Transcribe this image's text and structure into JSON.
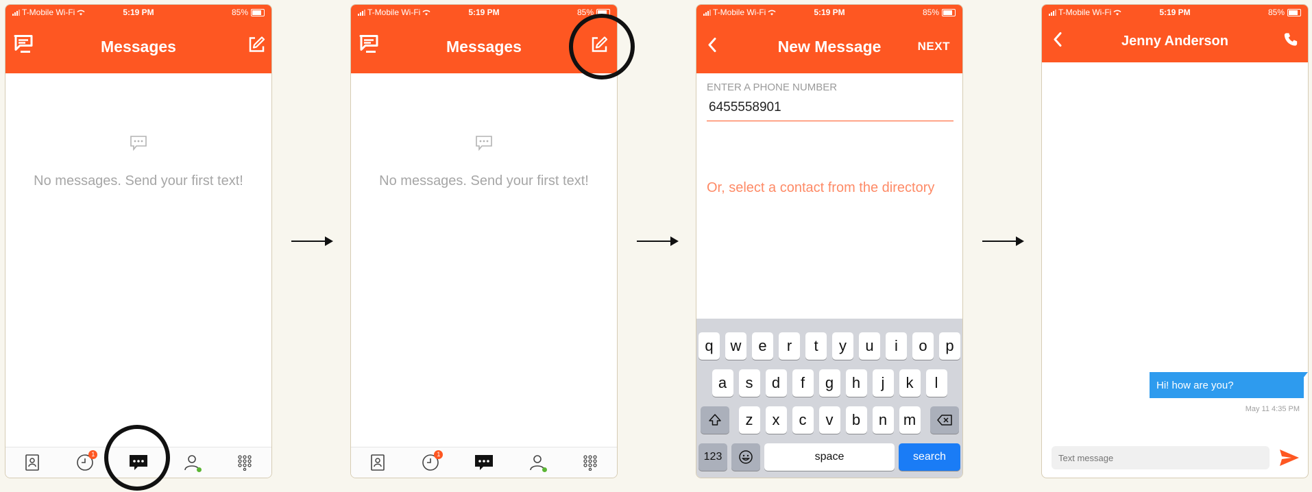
{
  "status_bar": {
    "carrier": "T-Mobile Wi-Fi",
    "time": "5:19 PM",
    "battery": "85%"
  },
  "screen1": {
    "title": "Messages",
    "empty_text": "No messages. Send your first text!",
    "recents_badge": "1"
  },
  "screen2": {
    "title": "Messages",
    "empty_text": "No messages. Send your first text!",
    "recents_badge": "1"
  },
  "screen3": {
    "title": "New Message",
    "next_label": "NEXT",
    "phone_label": "ENTER A PHONE NUMBER",
    "phone_value": "6455558901",
    "directory_link": "Or, select a contact from the directory",
    "keyboard": {
      "row1": [
        "q",
        "w",
        "e",
        "r",
        "t",
        "y",
        "u",
        "i",
        "o",
        "p"
      ],
      "row2": [
        "a",
        "s",
        "d",
        "f",
        "g",
        "h",
        "j",
        "k",
        "l"
      ],
      "row3": [
        "z",
        "x",
        "c",
        "v",
        "b",
        "n",
        "m"
      ],
      "numbers_key": "123",
      "space_key": "space",
      "search_key": "search"
    }
  },
  "screen4": {
    "title": "Jenny Anderson",
    "message_text": "Hi! how are you?",
    "message_time": "May 11 4:35 PM",
    "composer_placeholder": "Text message"
  },
  "icons": {
    "app_logo": "app-logo-icon",
    "compose": "compose-icon",
    "back": "chevron-left-icon",
    "phone": "phone-icon",
    "send": "send-icon",
    "chat": "chat-bubble-icon"
  },
  "colors": {
    "accent": "#fe5722",
    "link": "#fe8a66",
    "bubble": "#2e9bee",
    "keyboard_action": "#1a7cf6",
    "online": "#5bb534"
  }
}
